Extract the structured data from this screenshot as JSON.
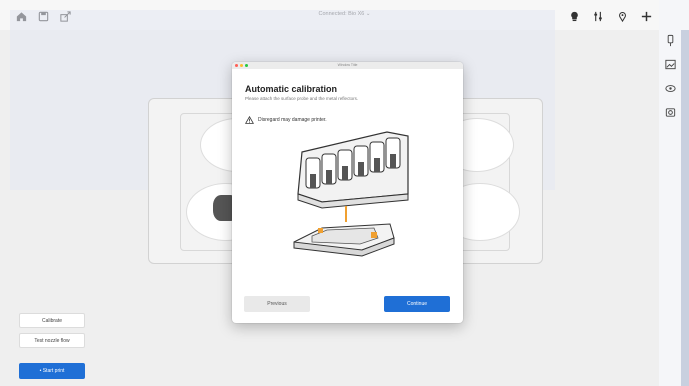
{
  "toolbar": {
    "left_icons": [
      "home-icon",
      "save-icon",
      "share-icon"
    ],
    "connection_label": "Connected: Bio X6 ⌄",
    "right_icons": [
      "bulb-icon",
      "sliders-icon",
      "location-icon",
      "fan-icon",
      "power-icon"
    ]
  },
  "right_sidebar": {
    "icons": [
      "syringe-icon",
      "image-icon",
      "eye-icon",
      "camera-icon"
    ]
  },
  "left_panel": {
    "calibrate_label": "Calibrate",
    "test_nozzle_label": "Test nozzle flow",
    "start_print_label": "• Start print"
  },
  "dialog": {
    "window_title": "Window Title",
    "title": "Automatic calibration",
    "subtitle": "Please attach the surface probe and the metal reflectors.",
    "warning_text": "Disregard may damage printer.",
    "previous_label": "Previous",
    "continue_label": "Continue"
  },
  "colors": {
    "accent": "#1f6fd6",
    "illustration_orange": "#f0a030",
    "dot_red": "#ff5f57",
    "dot_yellow": "#febc2e",
    "dot_green": "#28c840"
  }
}
